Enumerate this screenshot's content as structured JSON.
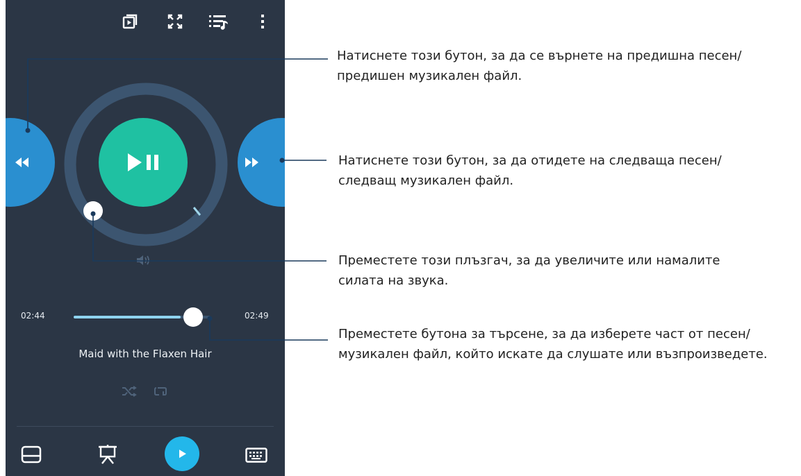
{
  "player": {
    "elapsed_time": "02:44",
    "total_time": "02:49",
    "progress_fraction": 0.78,
    "volume_fraction": 0.5,
    "song_title": "Maid with the Flaxen Hair",
    "top_icons": [
      "cast-screen-icon",
      "fullscreen-icon",
      "playlist-icon",
      "more-options-icon"
    ],
    "bottom_icons": [
      "touchpad-icon",
      "presentation-icon",
      "media-play-icon",
      "keyboard-icon"
    ],
    "colors": {
      "background": "#2b3645",
      "play_button": "#1fc1a2",
      "skip_buttons": "#2a8fd0",
      "volume_ring": "#3c5570",
      "bottom_play": "#23b7ea"
    }
  },
  "callouts": [
    {
      "line1": "Натиснете този бутон, за да се върнете на предишна песен/",
      "line2": "предишен музикален файл."
    },
    {
      "line1": "Натиснете този бутон, за да отидете на следваща песен/",
      "line2": "следващ музикален файл."
    },
    {
      "line1": "Преместете този плъзгач, за да увеличите или намалите",
      "line2": "силата на звука."
    },
    {
      "line1": "Преместете бутона за търсене, за да изберете част от песен/",
      "line2": "музикален файл, който искате да слушате или възпроизведете."
    }
  ]
}
